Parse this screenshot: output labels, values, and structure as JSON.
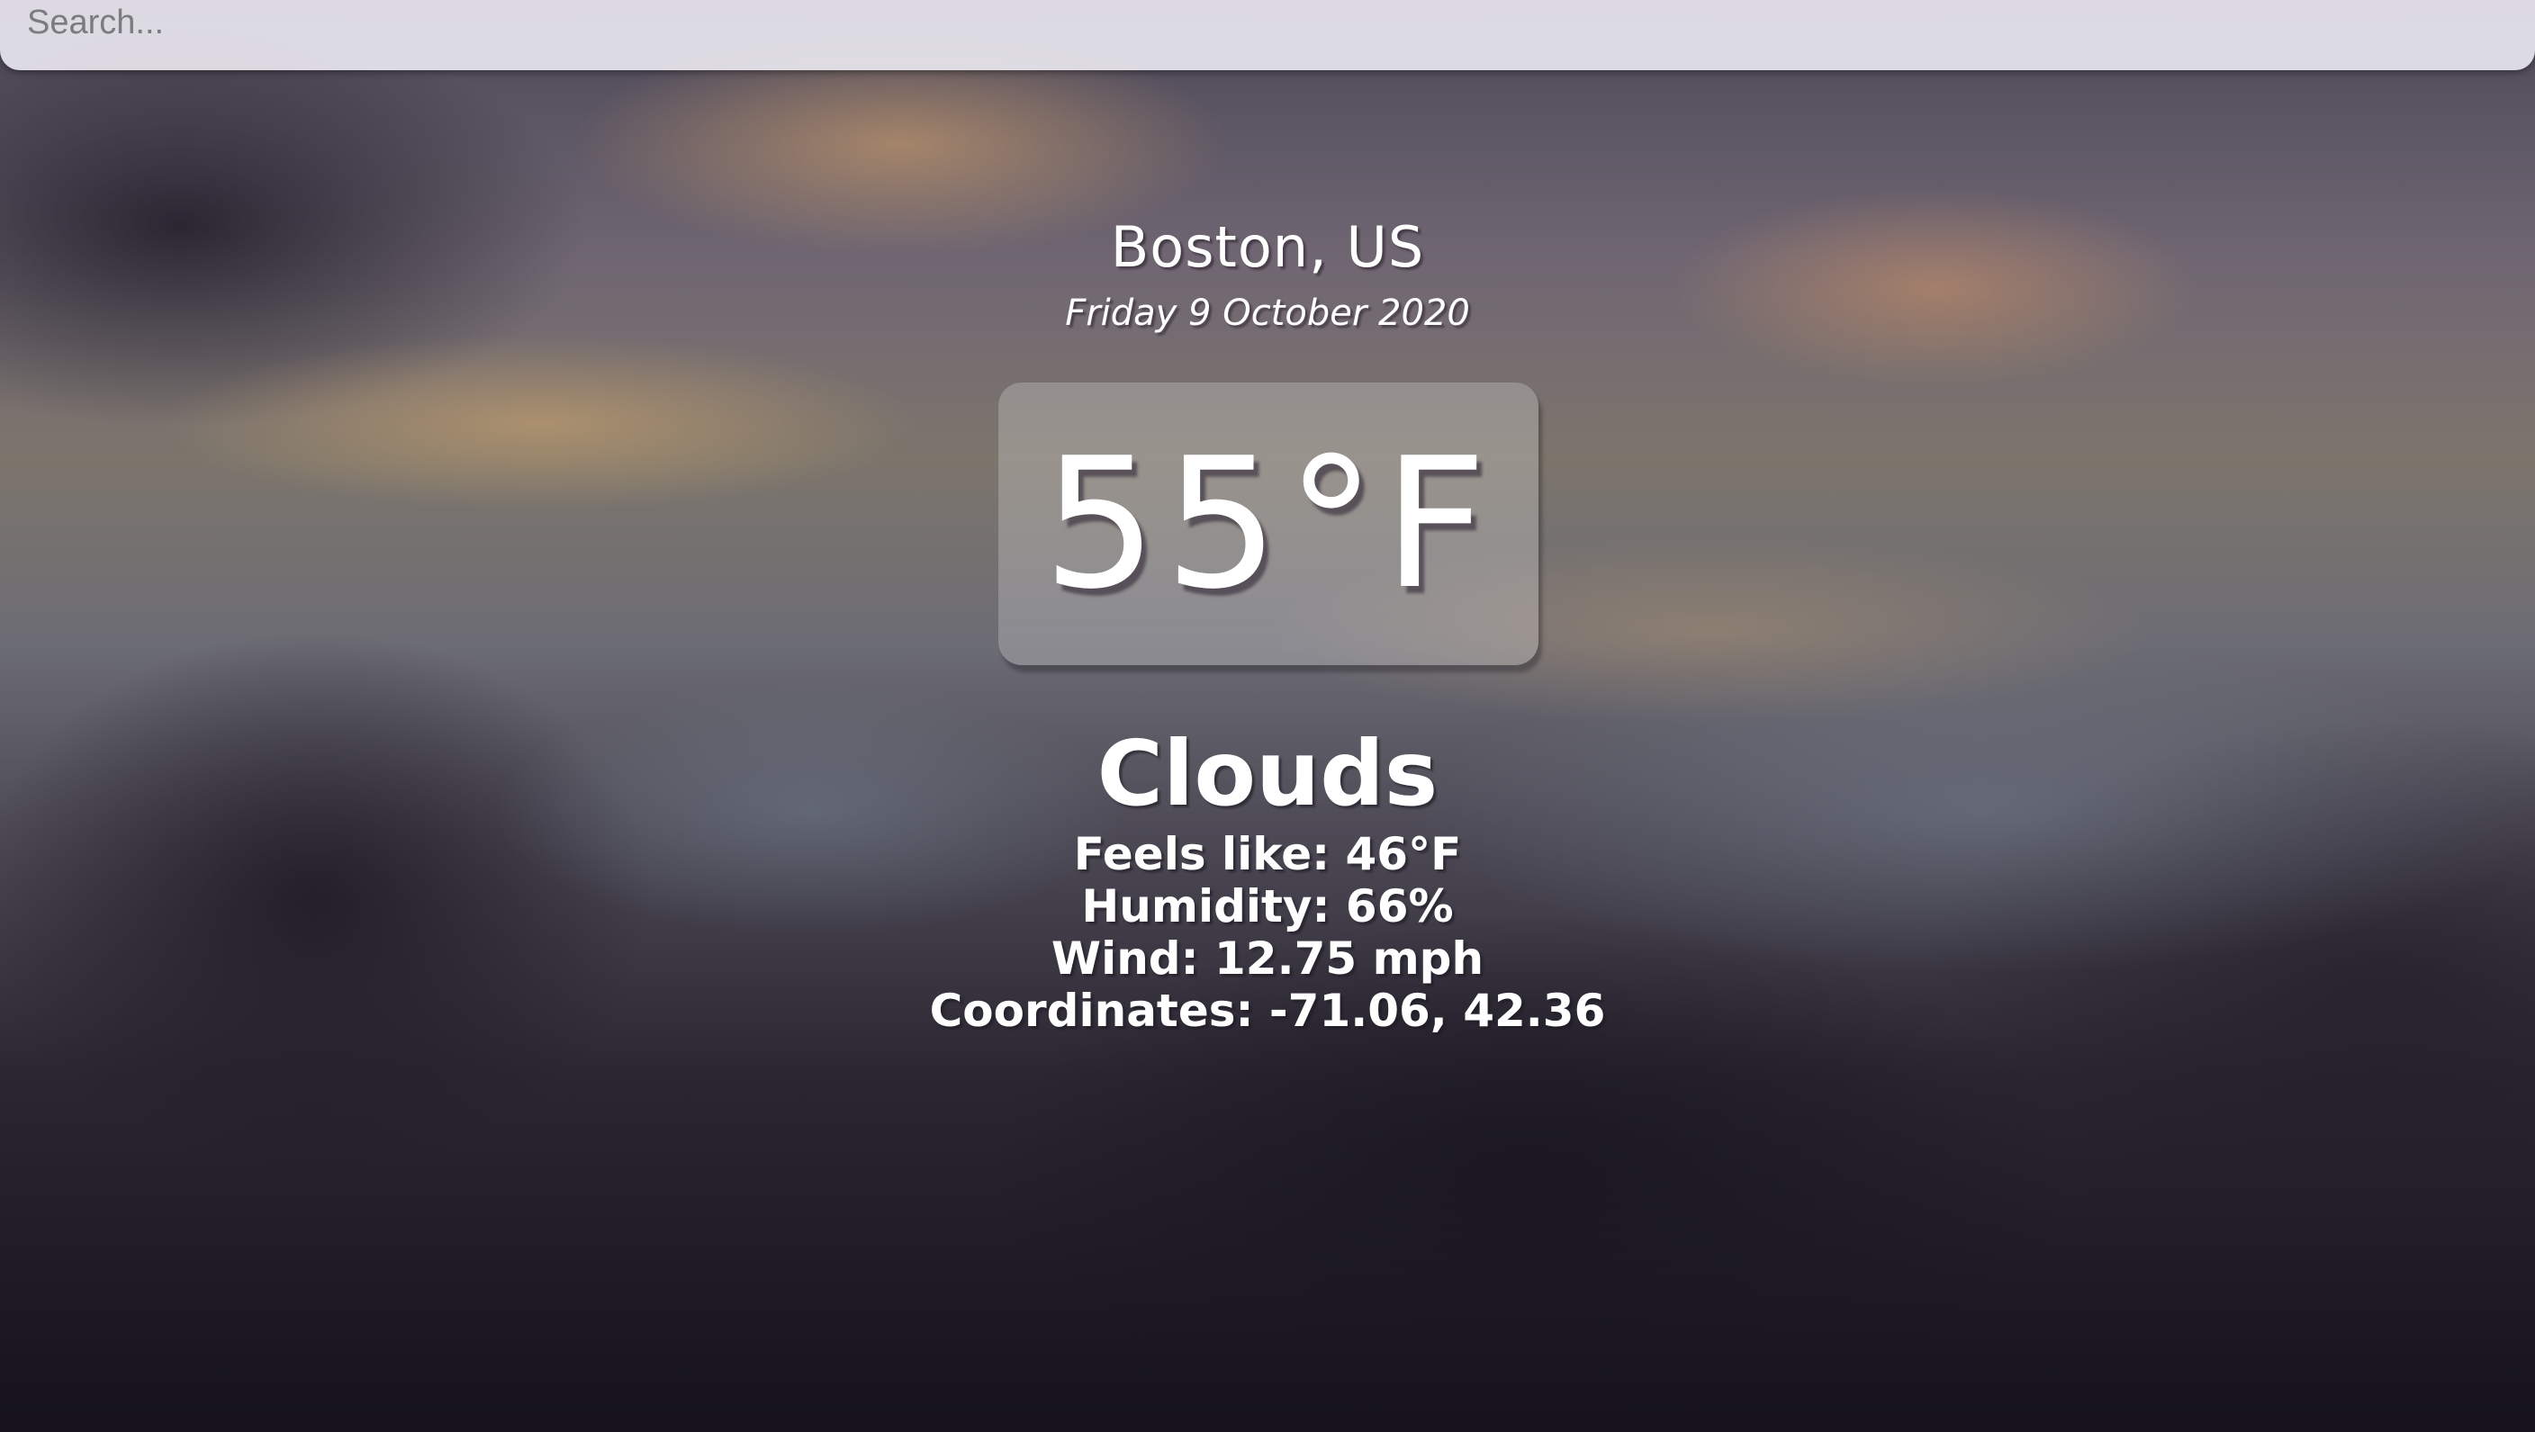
{
  "search": {
    "placeholder": "Search...",
    "value": ""
  },
  "location": {
    "city": "Boston, US",
    "date": "Friday 9 October 2020"
  },
  "weather": {
    "temperature": "55°F",
    "condition": "Clouds",
    "feels_like": "Feels like: 46°F",
    "humidity": "Humidity: 66%",
    "wind": "Wind: 12.75 mph",
    "coordinates": "Coordinates: -71.06, 42.36"
  },
  "colors": {
    "text": "#ffffff",
    "search_bg": "#e8e6ee",
    "placeholder": "#7b7b80"
  }
}
